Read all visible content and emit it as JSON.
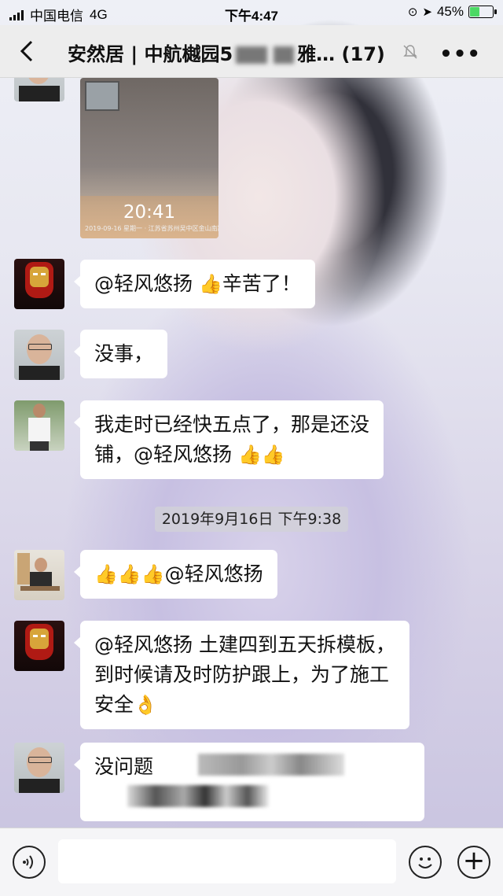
{
  "status_bar": {
    "carrier": "中国电信",
    "network": "4G",
    "time": "下午4:47",
    "battery": "45%",
    "battery_level": 0.45
  },
  "nav": {
    "title_prefix": "安然居 | 中航樾园",
    "title_visible_char": "5",
    "title_suffix": "雅…",
    "member_count": "(17)",
    "more_label": "•••"
  },
  "messages": [
    {
      "type": "image",
      "overlay_time": "20:41",
      "caption": "2019-09-16 星期一 · 江苏省苏州吴中区金山南路"
    },
    {
      "type": "text",
      "avatar": "ironman-avatar",
      "text_parts": [
        "@轻风悠扬 ",
        "👍",
        "辛苦了！"
      ]
    },
    {
      "type": "text",
      "avatar": "man-glasses-avatar",
      "text": "没事，"
    },
    {
      "type": "text",
      "avatar": "man-white-shirt-avatar",
      "line1": "我走时已经快五点了，那是还没",
      "line2": "铺，@轻风悠扬 ",
      "emoji": "👍👍"
    },
    {
      "type": "timestamp",
      "text": "2019年9月16日 下午9:38"
    },
    {
      "type": "text",
      "avatar": "man-desk-avatar",
      "emoji": "👍👍👍",
      "text": "@轻风悠扬"
    },
    {
      "type": "text",
      "avatar": "ironman-avatar",
      "line1": "@轻风悠扬 土建四到五天拆模板，",
      "line2": "到时候请及时防护跟上，为了施工",
      "line3": "安全",
      "emoji": "👌"
    },
    {
      "type": "text",
      "avatar": "man-glasses-avatar",
      "text": "没问题"
    }
  ],
  "input": {
    "voice_icon": "voice-icon",
    "emoji_icon": "emoji-icon",
    "plus_label": "+"
  }
}
